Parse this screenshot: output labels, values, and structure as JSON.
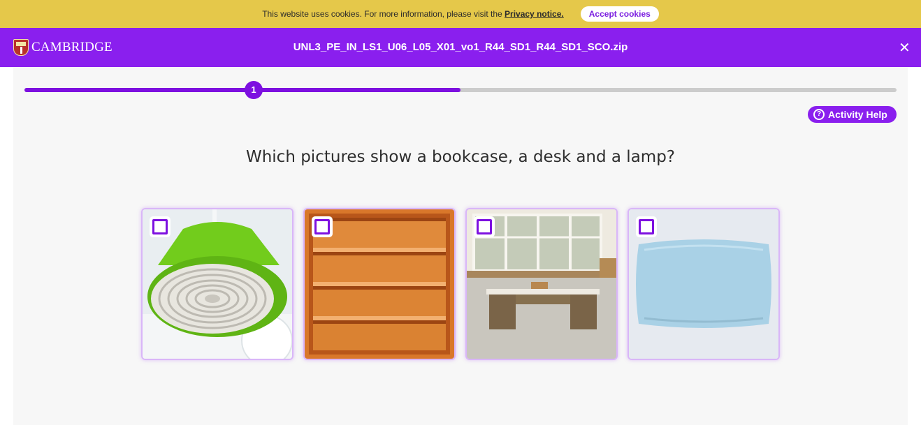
{
  "cookie_banner": {
    "text": "This website uses cookies. For more information, please visit the",
    "link_text": "Privacy notice.",
    "accept_label": "Accept cookies"
  },
  "header": {
    "brand": "CAMBRIDGE",
    "file_title": "UNL3_PE_IN_LS1_U06_L05_X01_vo1_R44_SD1_R44_SD1_SCO.zip",
    "close_icon": "close-icon"
  },
  "activity": {
    "progress_fraction": 0.5,
    "current_step": "1",
    "help_label": "Activity Help",
    "question": "Which pictures show a bookcase, a desk and a lamp?",
    "options": [
      {
        "picture": "lamp",
        "checked": false
      },
      {
        "picture": "bookcase",
        "checked": false
      },
      {
        "picture": "desk",
        "checked": false
      },
      {
        "picture": "pillow",
        "checked": false
      }
    ]
  },
  "colors": {
    "brand_purple": "#8a1fee",
    "accent_purple": "#7d10e0",
    "cookie_yellow": "#e5c84a",
    "panel_gray": "#f7f7f7"
  }
}
